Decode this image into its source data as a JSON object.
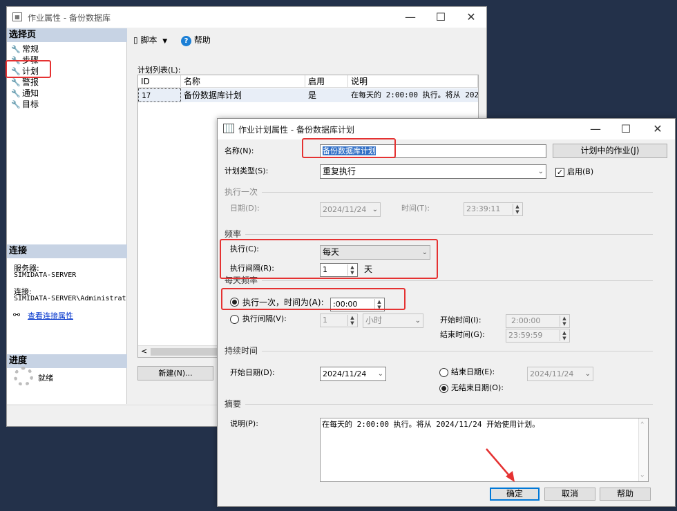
{
  "job_window": {
    "title": "作业属性 - 备份数据库",
    "controls": {
      "minimize": "—",
      "maximize": "☐",
      "close": "✕"
    },
    "select_page": {
      "header": "选择页",
      "items": [
        {
          "label": "常规",
          "icon": "wrench-icon"
        },
        {
          "label": "步骤",
          "icon": "wrench-icon"
        },
        {
          "label": "计划",
          "icon": "wrench-icon"
        },
        {
          "label": "警报",
          "icon": "wrench-icon"
        },
        {
          "label": "通知",
          "icon": "wrench-icon"
        },
        {
          "label": "目标",
          "icon": "wrench-icon"
        }
      ]
    },
    "connection": {
      "header": "连接",
      "server_label": "服务器:",
      "server_value": "SIMIDATA-SERVER",
      "conn_label": "连接:",
      "conn_value": "SIMIDATA-SERVER\\Administrat",
      "view_link": "查看连接属性"
    },
    "progress": {
      "header": "进度",
      "status": "就绪"
    },
    "toolbar": {
      "script": "脚本",
      "help": "帮助"
    },
    "schedule_list_label": "计划列表(L):",
    "grid": {
      "columns": [
        "ID",
        "名称",
        "启用",
        "说明"
      ],
      "rows": [
        [
          "17",
          "备份数据库计划",
          "是",
          "在每天的 2:00:00 执行。将从 202"
        ]
      ]
    },
    "new_button": "新建(N)..."
  },
  "schedule_dialog": {
    "title": "作业计划属性 - 备份数据库计划",
    "controls": {
      "minimize": "—",
      "maximize": "☐",
      "close": "✕"
    },
    "name_label": "名称(N):",
    "name_value": "备份数据库计划",
    "jobs_in_schedule_button": "计划中的作业(J)",
    "schedule_type_label": "计划类型(S):",
    "schedule_type_value": "重复执行",
    "enabled_label": "启用(B)",
    "enabled_checked": true,
    "one_time": {
      "title": "执行一次",
      "date_label": "日期(D):",
      "date_value": "2024/11/24",
      "time_label": "时间(T):",
      "time_value": "23:39:11"
    },
    "frequency": {
      "title": "频率",
      "occurs_label": "执行(C):",
      "occurs_value": "每天",
      "recurs_label": "执行间隔(R):",
      "recurs_value": "1",
      "recurs_unit": "天"
    },
    "daily_frequency": {
      "title": "每天频率",
      "once_label": "执行一次，时间为(A):",
      "once_value": ":00:00",
      "every_label": "执行间隔(V):",
      "every_value": "1",
      "every_unit": "小时",
      "start_time_label": "开始时间(I):",
      "start_time_value": "2:00:00",
      "end_time_label": "结束时间(G):",
      "end_time_value": "23:59:59"
    },
    "duration": {
      "title": "持续时间",
      "start_date_label": "开始日期(D):",
      "start_date_value": "2024/11/24",
      "end_date_label": "结束日期(E):",
      "end_date_value": "2024/11/24",
      "no_end_label": "无结束日期(O):"
    },
    "summary": {
      "title": "摘要",
      "desc_label": "说明(P):",
      "desc_value": "在每天的 2:00:00 执行。将从 2024/11/24 开始使用计划。"
    },
    "buttons": {
      "ok": "确定",
      "cancel": "取消",
      "help": "帮助"
    }
  },
  "colors": {
    "annotation": "#e53232",
    "desktop": "#23314a",
    "section_header": "#c7d3e4"
  }
}
